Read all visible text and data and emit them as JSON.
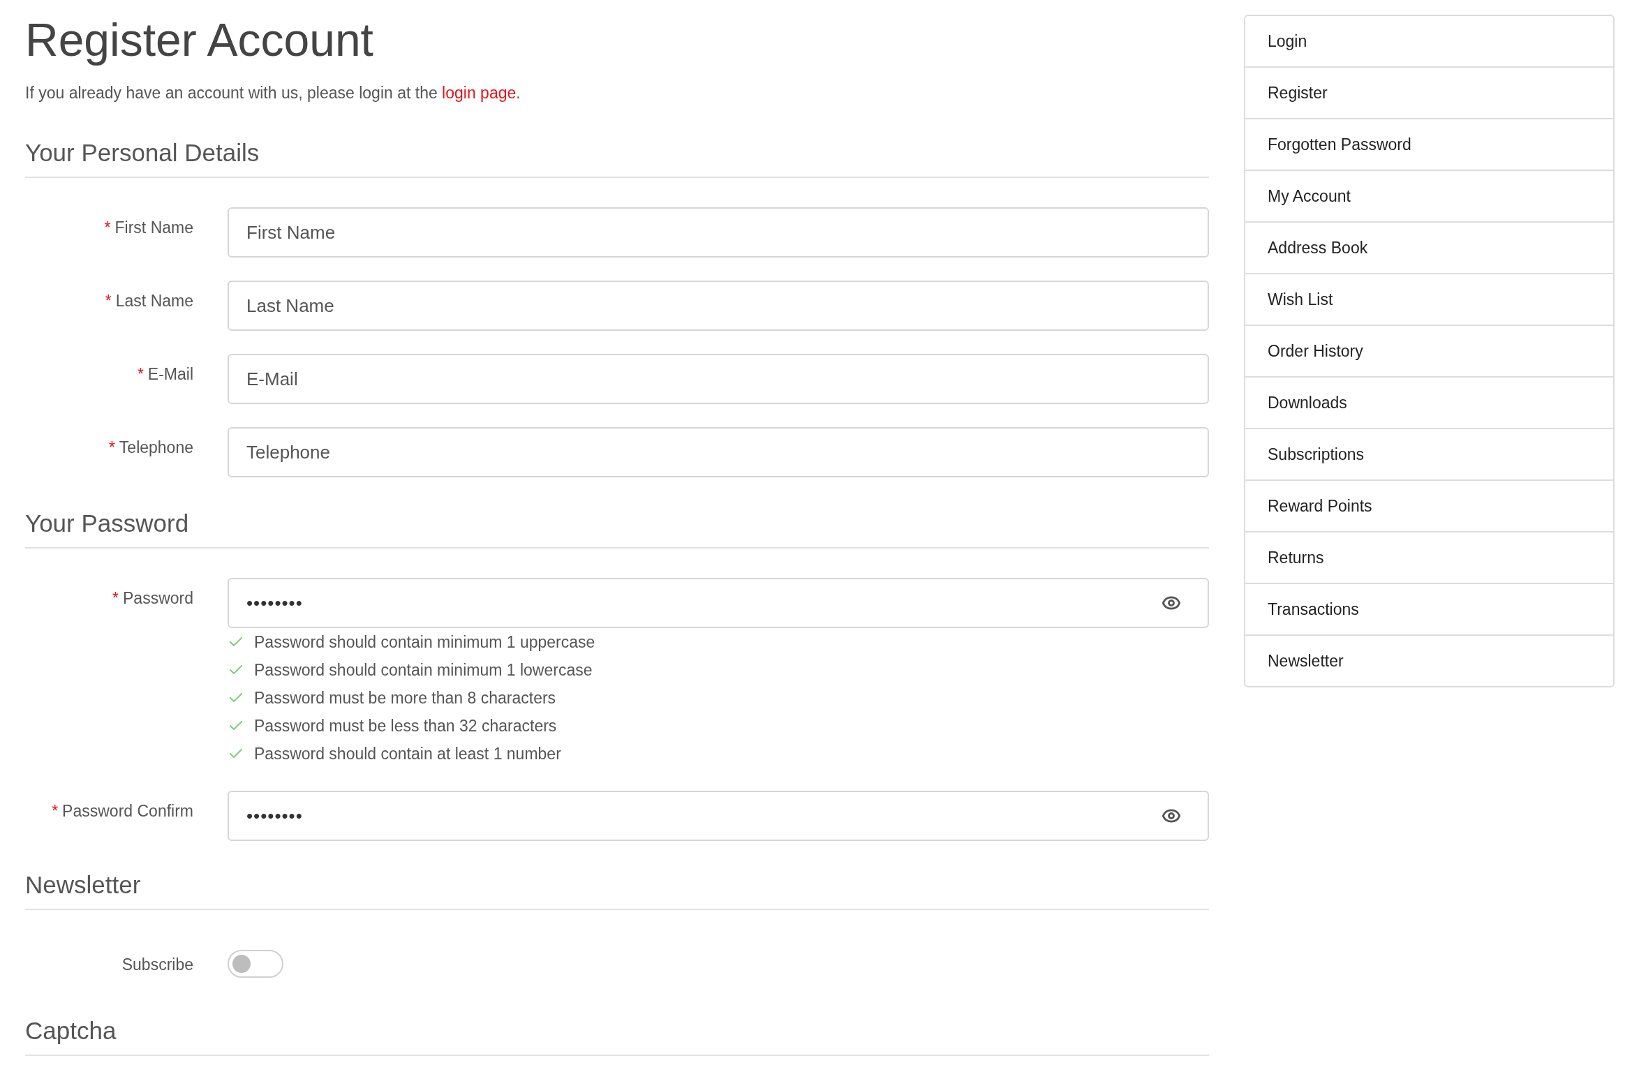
{
  "title": "Register Account",
  "intro": {
    "before": "If you already have an account with us, please login at the ",
    "link": "login page",
    "after": "."
  },
  "required_mark": "*",
  "sections": [
    {
      "heading": "Your Personal Details",
      "fields": [
        {
          "kind": "text",
          "label": "First Name",
          "required": true,
          "placeholder": "First Name"
        },
        {
          "kind": "text",
          "label": "Last Name",
          "required": true,
          "placeholder": "Last Name"
        },
        {
          "kind": "text",
          "label": "E-Mail",
          "required": true,
          "placeholder": "E-Mail"
        },
        {
          "kind": "text",
          "label": "Telephone",
          "required": true,
          "placeholder": "Telephone"
        }
      ]
    },
    {
      "heading": "Your Password",
      "fields": [
        {
          "kind": "password",
          "label": "Password",
          "required": true,
          "value": "••••••••",
          "rules": [
            {
              "text": "Password should contain minimum 1 uppercase",
              "met": true
            },
            {
              "text": "Password should contain minimum 1 lowercase",
              "met": true
            },
            {
              "text": "Password must be more than 8 characters",
              "met": true
            },
            {
              "text": "Password must be less than 32 characters",
              "met": true
            },
            {
              "text": "Password should contain at least 1 number",
              "met": true
            }
          ]
        },
        {
          "kind": "password",
          "label": "Password Confirm",
          "required": true,
          "value": "••••••••"
        }
      ]
    },
    {
      "heading": "Newsletter",
      "fields": [
        {
          "kind": "toggle",
          "label": "Subscribe",
          "required": false,
          "on": false
        }
      ]
    },
    {
      "heading": "Captcha"
    }
  ],
  "sidebar": {
    "items": [
      "Login",
      "Register",
      "Forgotten Password",
      "My Account",
      "Address Book",
      "Wish List",
      "Order History",
      "Downloads",
      "Subscriptions",
      "Reward Points",
      "Returns",
      "Transactions",
      "Newsletter"
    ]
  }
}
